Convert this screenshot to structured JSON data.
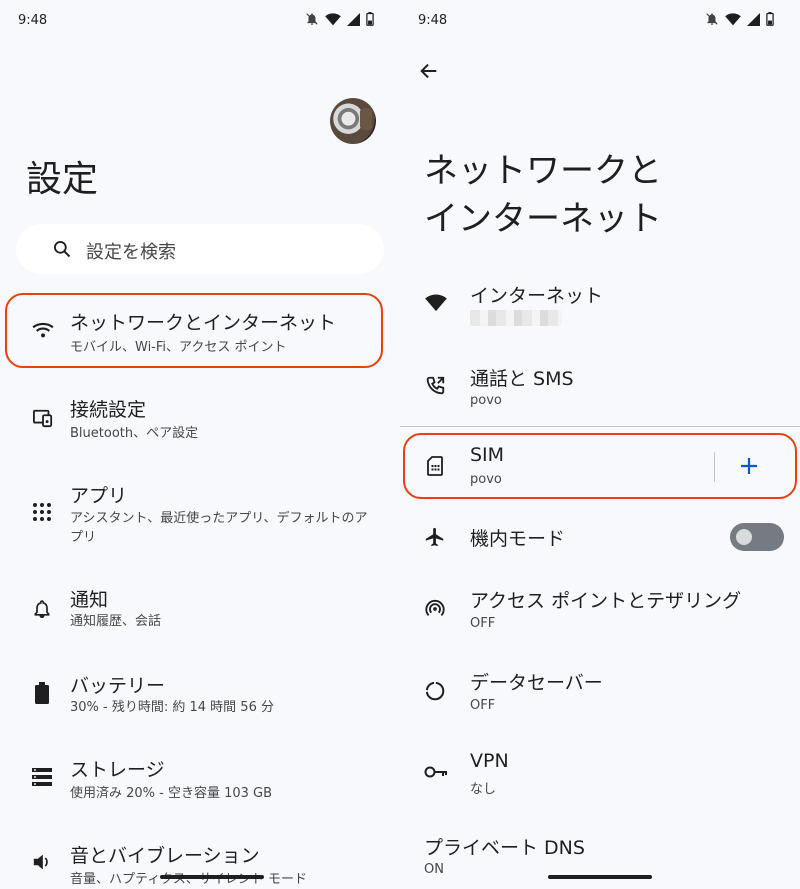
{
  "left": {
    "status": {
      "time": "9:48"
    },
    "title": "設定",
    "search": {
      "placeholder": "設定を検索"
    },
    "items": [
      {
        "title": "ネットワークとインターネット",
        "subtitle": "モバイル、Wi-Fi、アクセス ポイント",
        "icon": "wifi-icon"
      },
      {
        "title": "接続設定",
        "subtitle": "Bluetooth、ペア設定",
        "icon": "devices-icon"
      },
      {
        "title": "アプリ",
        "subtitle": "アシスタント、最近使ったアプリ、デフォルトのアプリ",
        "icon": "apps-grid-icon"
      },
      {
        "title": "通知",
        "subtitle": "通知履歴、会話",
        "icon": "bell-icon"
      },
      {
        "title": "バッテリー",
        "subtitle": "30% - 残り時間: 約 14 時間 56 分",
        "icon": "battery-icon"
      },
      {
        "title": "ストレージ",
        "subtitle": "使用済み 20% - 空き容量 103 GB",
        "icon": "storage-icon"
      },
      {
        "title": "音とバイブレーション",
        "subtitle": "音量、ハプティクス、サイレント モード",
        "icon": "volume-icon"
      }
    ]
  },
  "right": {
    "status": {
      "time": "9:48"
    },
    "title_line1": "ネットワークと",
    "title_line2": "インターネット",
    "items": [
      {
        "title": "インターネット",
        "subtitle": "",
        "icon": "wifi-icon"
      },
      {
        "title": "通話と SMS",
        "subtitle": "povo",
        "icon": "phone-forward-icon"
      },
      {
        "title": "SIM",
        "subtitle": "povo",
        "icon": "sim-card-icon"
      },
      {
        "title": "機内モード",
        "subtitle": "",
        "icon": "airplane-icon",
        "toggle": false
      },
      {
        "title": "アクセス ポイントとテザリング",
        "subtitle": "OFF",
        "icon": "hotspot-icon"
      },
      {
        "title": "データセーバー",
        "subtitle": "OFF",
        "icon": "data-saver-icon"
      },
      {
        "title": "VPN",
        "subtitle": "なし",
        "icon": "vpn-key-icon"
      },
      {
        "title": "プライベート DNS",
        "subtitle": "ON",
        "icon": ""
      }
    ]
  },
  "colors": {
    "highlight": "#e8410f",
    "accent": "#0b57d0"
  }
}
